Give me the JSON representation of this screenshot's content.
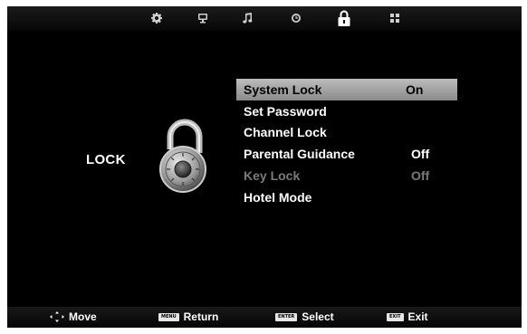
{
  "tabs": [
    {
      "icon": "gear-icon",
      "active": false
    },
    {
      "icon": "monitor-icon",
      "active": false
    },
    {
      "icon": "music-note-icon",
      "active": false
    },
    {
      "icon": "clock-icon",
      "active": false
    },
    {
      "icon": "lock-icon",
      "active": true
    },
    {
      "icon": "grid-icon",
      "active": false
    }
  ],
  "section": {
    "title": "LOCK",
    "icon": "padlock-icon"
  },
  "menu": {
    "items": [
      {
        "label": "System Lock",
        "value": "On",
        "selected": true,
        "disabled": false
      },
      {
        "label": "Set Password",
        "value": "",
        "selected": false,
        "disabled": false
      },
      {
        "label": "Channel Lock",
        "value": "",
        "selected": false,
        "disabled": false
      },
      {
        "label": "Parental Guidance",
        "value": "Off",
        "selected": false,
        "disabled": false
      },
      {
        "label": "Key Lock",
        "value": "Off",
        "selected": false,
        "disabled": true
      },
      {
        "label": "Hotel Mode",
        "value": "",
        "selected": false,
        "disabled": false
      }
    ]
  },
  "footer": {
    "move": {
      "label": "Move",
      "icon": "dpad-icon"
    },
    "return": {
      "label": "Return",
      "key": "MENU"
    },
    "select": {
      "label": "Select",
      "key": "ENTER"
    },
    "exit": {
      "label": "Exit",
      "key": "EXIT"
    }
  },
  "colors": {
    "selected_bar": "#a8a8a8",
    "disabled_text": "#7a7a7a",
    "background": "#000000"
  }
}
